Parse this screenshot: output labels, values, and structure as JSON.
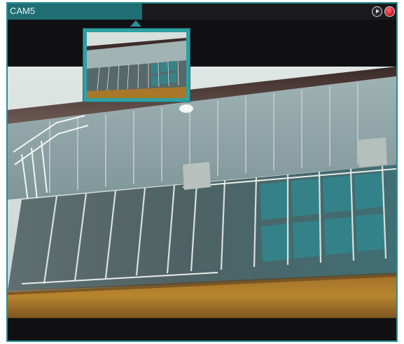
{
  "camera": {
    "title": "CAM5"
  },
  "controls": {
    "play_icon": "play-circle-icon",
    "record_icon": "record-dot-icon",
    "record_color": "#d0202e",
    "accent": "#2a8f95"
  }
}
